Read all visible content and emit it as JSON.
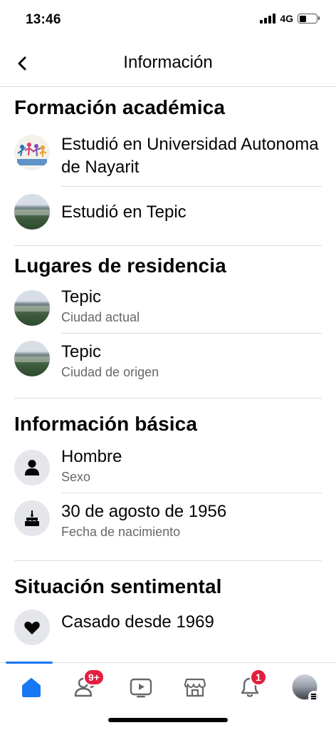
{
  "status_bar": {
    "time": "13:46",
    "network": "4G",
    "icons": [
      "signal-icon",
      "battery-icon"
    ]
  },
  "header": {
    "title": "Información",
    "back_icon": "chevron-left-icon"
  },
  "sections": {
    "education": {
      "title": "Formación académica",
      "items": [
        {
          "primary": "Estudió en Universidad Autonoma de Nayarit"
        },
        {
          "primary": "Estudió en Tepic"
        }
      ]
    },
    "places": {
      "title": "Lugares de residencia",
      "items": [
        {
          "primary": "Tepic",
          "secondary": "Ciudad actual"
        },
        {
          "primary": "Tepic",
          "secondary": "Ciudad de origen"
        }
      ]
    },
    "basic": {
      "title": "Información básica",
      "items": [
        {
          "primary": "Hombre",
          "secondary": "Sexo",
          "icon": "person-icon"
        },
        {
          "primary": "30 de agosto de 1956",
          "secondary": "Fecha de nacimiento",
          "icon": "birthday-cake-icon"
        }
      ]
    },
    "relationship": {
      "title": "Situación sentimental",
      "items": [
        {
          "primary": "Casado desde 1969",
          "icon": "heart-icon"
        }
      ]
    }
  },
  "bottom_nav": {
    "items": [
      {
        "name": "home",
        "icon": "home-icon",
        "active": true
      },
      {
        "name": "friends",
        "icon": "friends-icon",
        "badge": "9+"
      },
      {
        "name": "video",
        "icon": "video-icon"
      },
      {
        "name": "marketplace",
        "icon": "marketplace-icon"
      },
      {
        "name": "notifications",
        "icon": "bell-icon",
        "badge": "1"
      },
      {
        "name": "menu",
        "icon": "profile-menu-icon"
      }
    ]
  },
  "colors": {
    "accent": "#1877f2",
    "badge": "#e41e3f",
    "secondary_text": "#65676b",
    "divider": "#dadde1"
  }
}
